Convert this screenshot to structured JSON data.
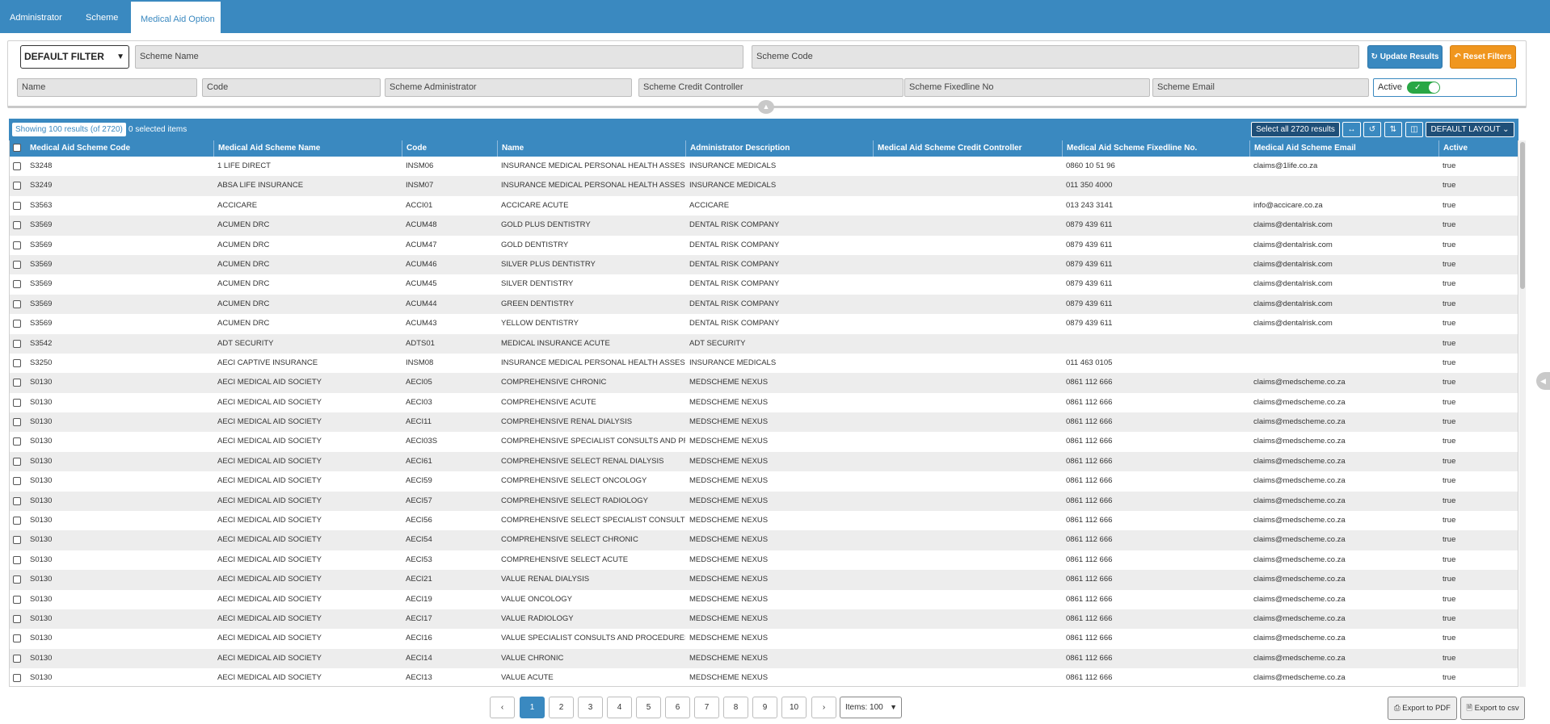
{
  "nav": {
    "tabs": [
      "Administrator",
      "Scheme",
      "Medical Aid Option"
    ],
    "active_index": 2
  },
  "filters": {
    "default_filter": "DEFAULT FILTER",
    "scheme_name": "Scheme Name",
    "scheme_code": "Scheme Code",
    "update_label": "Update Results",
    "reset_label": "Reset Filters",
    "name": "Name",
    "code": "Code",
    "scheme_administrator": "Scheme Administrator",
    "scheme_credit_controller": "Scheme Credit Controller",
    "scheme_fixedline": "Scheme Fixedline No",
    "scheme_email": "Scheme Email",
    "active_label": "Active",
    "active_on": true
  },
  "results": {
    "showing": "Showing 100 results (of 2720)",
    "selected": "0 selected items",
    "select_all": "Select all 2720 results",
    "layout": "DEFAULT LAYOUT"
  },
  "table": {
    "columns": [
      "Medical Aid Scheme Code",
      "Medical Aid Scheme Name",
      "Code",
      "Name",
      "Administrator Description",
      "Medical Aid Scheme Credit Controller",
      "Medical Aid Scheme Fixedline No.",
      "Medical Aid Scheme Email",
      "Active"
    ],
    "rows": [
      [
        "S3248",
        "1 LIFE DIRECT",
        "INSM06",
        "INSURANCE MEDICAL PERSONAL HEALTH ASSESS",
        "INSURANCE MEDICALS",
        "",
        "0860 10 51 96",
        "claims@1life.co.za",
        "true"
      ],
      [
        "S3249",
        "ABSA LIFE INSURANCE",
        "INSM07",
        "INSURANCE MEDICAL PERSONAL HEALTH ASSESS",
        "INSURANCE MEDICALS",
        "",
        "011 350 4000",
        "",
        "true"
      ],
      [
        "S3563",
        "ACCICARE",
        "ACCI01",
        "ACCICARE ACUTE",
        "ACCICARE",
        "",
        "013 243 3141",
        "info@accicare.co.za",
        "true"
      ],
      [
        "S3569",
        "ACUMEN DRC",
        "ACUM48",
        "GOLD PLUS DENTISTRY",
        "DENTAL RISK COMPANY",
        "",
        "0879 439 611",
        "claims@dentalrisk.com",
        "true"
      ],
      [
        "S3569",
        "ACUMEN DRC",
        "ACUM47",
        "GOLD DENTISTRY",
        "DENTAL RISK COMPANY",
        "",
        "0879 439 611",
        "claims@dentalrisk.com",
        "true"
      ],
      [
        "S3569",
        "ACUMEN DRC",
        "ACUM46",
        "SILVER PLUS DENTISTRY",
        "DENTAL RISK COMPANY",
        "",
        "0879 439 611",
        "claims@dentalrisk.com",
        "true"
      ],
      [
        "S3569",
        "ACUMEN DRC",
        "ACUM45",
        "SILVER DENTISTRY",
        "DENTAL RISK COMPANY",
        "",
        "0879 439 611",
        "claims@dentalrisk.com",
        "true"
      ],
      [
        "S3569",
        "ACUMEN DRC",
        "ACUM44",
        "GREEN DENTISTRY",
        "DENTAL RISK COMPANY",
        "",
        "0879 439 611",
        "claims@dentalrisk.com",
        "true"
      ],
      [
        "S3569",
        "ACUMEN DRC",
        "ACUM43",
        "YELLOW DENTISTRY",
        "DENTAL RISK COMPANY",
        "",
        "0879 439 611",
        "claims@dentalrisk.com",
        "true"
      ],
      [
        "S3542",
        "ADT SECURITY",
        "ADTS01",
        "MEDICAL INSURANCE ACUTE",
        "ADT SECURITY",
        "",
        "",
        "",
        "true"
      ],
      [
        "S3250",
        "AECI CAPTIVE INSURANCE",
        "INSM08",
        "INSURANCE MEDICAL PERSONAL HEALTH ASSESS",
        "INSURANCE MEDICALS",
        "",
        "011 463 0105",
        "",
        "true"
      ],
      [
        "S0130",
        "AECI MEDICAL AID SOCIETY",
        "AECI05",
        "COMPREHENSIVE CHRONIC",
        "MEDSCHEME NEXUS",
        "",
        "0861 112 666",
        "claims@medscheme.co.za",
        "true"
      ],
      [
        "S0130",
        "AECI MEDICAL AID SOCIETY",
        "AECI03",
        "COMPREHENSIVE ACUTE",
        "MEDSCHEME NEXUS",
        "",
        "0861 112 666",
        "claims@medscheme.co.za",
        "true"
      ],
      [
        "S0130",
        "AECI MEDICAL AID SOCIETY",
        "AECI11",
        "COMPREHENSIVE RENAL DIALYSIS",
        "MEDSCHEME NEXUS",
        "",
        "0861 112 666",
        "claims@medscheme.co.za",
        "true"
      ],
      [
        "S0130",
        "AECI MEDICAL AID SOCIETY",
        "AECI03S",
        "COMPREHENSIVE SPECIALIST CONSULTS AND PR",
        "MEDSCHEME NEXUS",
        "",
        "0861 112 666",
        "claims@medscheme.co.za",
        "true"
      ],
      [
        "S0130",
        "AECI MEDICAL AID SOCIETY",
        "AECI61",
        "COMPREHENSIVE SELECT RENAL DIALYSIS",
        "MEDSCHEME NEXUS",
        "",
        "0861 112 666",
        "claims@medscheme.co.za",
        "true"
      ],
      [
        "S0130",
        "AECI MEDICAL AID SOCIETY",
        "AECI59",
        "COMPREHENSIVE SELECT ONCOLOGY",
        "MEDSCHEME NEXUS",
        "",
        "0861 112 666",
        "claims@medscheme.co.za",
        "true"
      ],
      [
        "S0130",
        "AECI MEDICAL AID SOCIETY",
        "AECI57",
        "COMPREHENSIVE SELECT RADIOLOGY",
        "MEDSCHEME NEXUS",
        "",
        "0861 112 666",
        "claims@medscheme.co.za",
        "true"
      ],
      [
        "S0130",
        "AECI MEDICAL AID SOCIETY",
        "AECI56",
        "COMPREHENSIVE SELECT SPECIALIST CONSULTS",
        "MEDSCHEME NEXUS",
        "",
        "0861 112 666",
        "claims@medscheme.co.za",
        "true"
      ],
      [
        "S0130",
        "AECI MEDICAL AID SOCIETY",
        "AECI54",
        "COMPREHENSIVE SELECT CHRONIC",
        "MEDSCHEME NEXUS",
        "",
        "0861 112 666",
        "claims@medscheme.co.za",
        "true"
      ],
      [
        "S0130",
        "AECI MEDICAL AID SOCIETY",
        "AECI53",
        "COMPREHENSIVE SELECT ACUTE",
        "MEDSCHEME NEXUS",
        "",
        "0861 112 666",
        "claims@medscheme.co.za",
        "true"
      ],
      [
        "S0130",
        "AECI MEDICAL AID SOCIETY",
        "AECI21",
        "VALUE RENAL DIALYSIS",
        "MEDSCHEME NEXUS",
        "",
        "0861 112 666",
        "claims@medscheme.co.za",
        "true"
      ],
      [
        "S0130",
        "AECI MEDICAL AID SOCIETY",
        "AECI19",
        "VALUE ONCOLOGY",
        "MEDSCHEME NEXUS",
        "",
        "0861 112 666",
        "claims@medscheme.co.za",
        "true"
      ],
      [
        "S0130",
        "AECI MEDICAL AID SOCIETY",
        "AECI17",
        "VALUE RADIOLOGY",
        "MEDSCHEME NEXUS",
        "",
        "0861 112 666",
        "claims@medscheme.co.za",
        "true"
      ],
      [
        "S0130",
        "AECI MEDICAL AID SOCIETY",
        "AECI16",
        "VALUE SPECIALIST CONSULTS AND PROCEDURES",
        "MEDSCHEME NEXUS",
        "",
        "0861 112 666",
        "claims@medscheme.co.za",
        "true"
      ],
      [
        "S0130",
        "AECI MEDICAL AID SOCIETY",
        "AECI14",
        "VALUE CHRONIC",
        "MEDSCHEME NEXUS",
        "",
        "0861 112 666",
        "claims@medscheme.co.za",
        "true"
      ],
      [
        "S0130",
        "AECI MEDICAL AID SOCIETY",
        "AECI13",
        "VALUE ACUTE",
        "MEDSCHEME NEXUS",
        "",
        "0861 112 666",
        "claims@medscheme.co.za",
        "true"
      ]
    ]
  },
  "pagination": {
    "prev": "‹",
    "next": "›",
    "pages": [
      "1",
      "2",
      "3",
      "4",
      "5",
      "6",
      "7",
      "8",
      "9",
      "10"
    ],
    "current": "1",
    "items_label": "Items: 100"
  },
  "export": {
    "pdf": "Export to PDF",
    "csv": "Export to csv"
  },
  "colors": {
    "primary": "#3a89c0",
    "reset": "#f0961e",
    "toggle_on": "#29a745"
  }
}
